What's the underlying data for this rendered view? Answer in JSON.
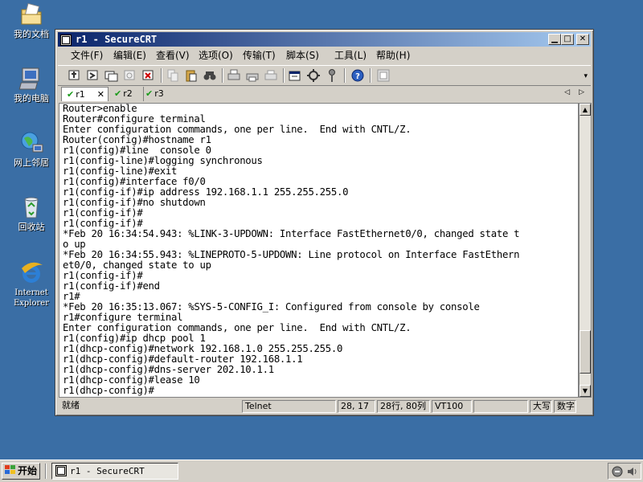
{
  "desktop": {
    "icons": [
      {
        "label": "我的文档",
        "icon": "my-documents-icon"
      },
      {
        "label": "我的电脑",
        "icon": "my-computer-icon"
      },
      {
        "label": "网上邻居",
        "icon": "network-places-icon"
      },
      {
        "label": "回收站",
        "icon": "recycle-bin-icon"
      },
      {
        "label": "Internet Explorer",
        "icon": "internet-explorer-icon"
      }
    ]
  },
  "window": {
    "title": "r1 - SecureCRT",
    "menu": [
      "文件(F)",
      "编辑(E)",
      "查看(V)",
      "选项(O)",
      "传输(T)",
      "脚本(S)",
      "工具(L)",
      "帮助(H)"
    ],
    "tabs": [
      {
        "label": "r1",
        "close": "✕"
      },
      {
        "label": "r2"
      },
      {
        "label": "r3"
      }
    ],
    "terminal_text": "Router>enable\nRouter#configure terminal\nEnter configuration commands, one per line.  End with CNTL/Z.\nRouter(config)#hostname r1\nr1(config)#line  console 0\nr1(config-line)#logging synchronous\nr1(config-line)#exit\nr1(config)#interface f0/0\nr1(config-if)#ip address 192.168.1.1 255.255.255.0\nr1(config-if)#no shutdown\nr1(config-if)#\nr1(config-if)#\n*Feb 20 16:34:54.943: %LINK-3-UPDOWN: Interface FastEthernet0/0, changed state t\no up\n*Feb 20 16:34:55.943: %LINEPROTO-5-UPDOWN: Line protocol on Interface FastEthern\net0/0, changed state to up\nr1(config-if)#\nr1(config-if)#end\nr1#\n*Feb 20 16:35:13.067: %SYS-5-CONFIG_I: Configured from console by console\nr1#configure terminal\nEnter configuration commands, one per line.  End with CNTL/Z.\nr1(config)#ip dhcp pool 1\nr1(dhcp-config)#network 192.168.1.0 255.255.255.0\nr1(dhcp-config)#default-router 192.168.1.1\nr1(dhcp-config)#dns-server 202.10.1.1\nr1(dhcp-config)#lease 10\nr1(dhcp-config)#",
    "status": {
      "ready": "就绪",
      "protocol": "Telnet",
      "cursor": "28, 17",
      "rows_cols": "28行, 80列",
      "emulation": "VT100",
      "caps": "大写",
      "num": "数字"
    }
  },
  "taskbar": {
    "start": "开始",
    "task": "r1 - SecureCRT"
  },
  "colors": {
    "desktop": "#3a6ea5",
    "title_start": "#0a246a",
    "title_end": "#a6caf0",
    "tab_check": "#1a9a1a"
  }
}
